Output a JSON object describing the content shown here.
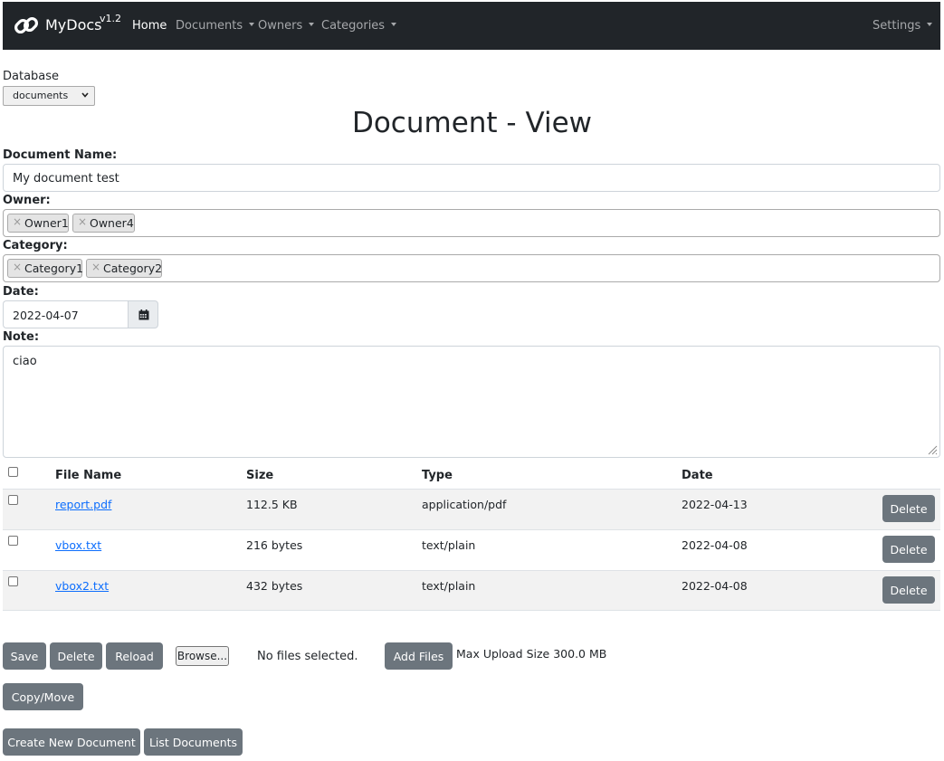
{
  "navbar": {
    "brand": "MyDocs",
    "version": "v1.2",
    "home": "Home",
    "documents": "Documents",
    "owners": "Owners",
    "categories": "Categories",
    "settings": "Settings"
  },
  "database": {
    "label": "Database",
    "selected": "documents"
  },
  "page_title": "Document - View",
  "form": {
    "name_label": "Document Name:",
    "name_value": "My document test",
    "owner_label": "Owner:",
    "owners": [
      "Owner1",
      "Owner4"
    ],
    "category_label": "Category:",
    "categories": [
      "Category1",
      "Category2"
    ],
    "date_label": "Date:",
    "date_value": "2022-04-07",
    "note_label": "Note:",
    "note_value": "ciao"
  },
  "tag_remove_symbol": "×",
  "files": {
    "columns": [
      "File Name",
      "Size",
      "Type",
      "Date"
    ],
    "rows": [
      {
        "name": "report.pdf",
        "size": "112.5 KB",
        "type": "application/pdf",
        "date": "2022-04-13",
        "delete": "Delete"
      },
      {
        "name": "vbox.txt",
        "size": "216 bytes",
        "type": "text/plain",
        "date": "2022-04-08",
        "delete": "Delete"
      },
      {
        "name": "vbox2.txt",
        "size": "432 bytes",
        "type": "text/plain",
        "date": "2022-04-08",
        "delete": "Delete"
      }
    ]
  },
  "actions": {
    "save": "Save",
    "delete": "Delete",
    "reload": "Reload",
    "browse": "Browse...",
    "no_files": "No files selected.",
    "add_files": "Add Files",
    "max_upload": "Max Upload Size 300.0 MB",
    "copy_move": "Copy/Move",
    "create_new": "Create New Document",
    "list_documents": "List Documents"
  },
  "colors": {
    "navbar_bg": "#212529",
    "button_bg": "#6c757d",
    "link": "#0d6efd",
    "striped_row": "#f2f2f2"
  }
}
